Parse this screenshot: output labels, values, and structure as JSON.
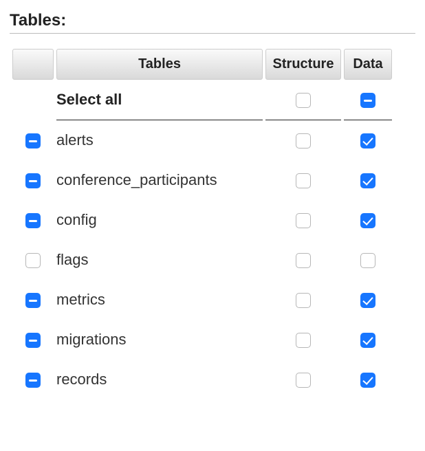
{
  "heading": "Tables:",
  "columns": {
    "tables": "Tables",
    "structure": "Structure",
    "data": "Data"
  },
  "select_all": {
    "label": "Select all",
    "structure_state": "unchecked",
    "data_state": "mixed"
  },
  "rows": [
    {
      "name": "alerts",
      "toggle_state": "mixed",
      "structure_state": "unchecked",
      "data_state": "checked"
    },
    {
      "name": "conference_participants",
      "toggle_state": "mixed",
      "structure_state": "unchecked",
      "data_state": "checked"
    },
    {
      "name": "config",
      "toggle_state": "mixed",
      "structure_state": "unchecked",
      "data_state": "checked"
    },
    {
      "name": "flags",
      "toggle_state": "unchecked",
      "structure_state": "unchecked",
      "data_state": "unchecked"
    },
    {
      "name": "metrics",
      "toggle_state": "mixed",
      "structure_state": "unchecked",
      "data_state": "checked"
    },
    {
      "name": "migrations",
      "toggle_state": "mixed",
      "structure_state": "unchecked",
      "data_state": "checked"
    },
    {
      "name": "records",
      "toggle_state": "mixed",
      "structure_state": "unchecked",
      "data_state": "checked"
    }
  ]
}
